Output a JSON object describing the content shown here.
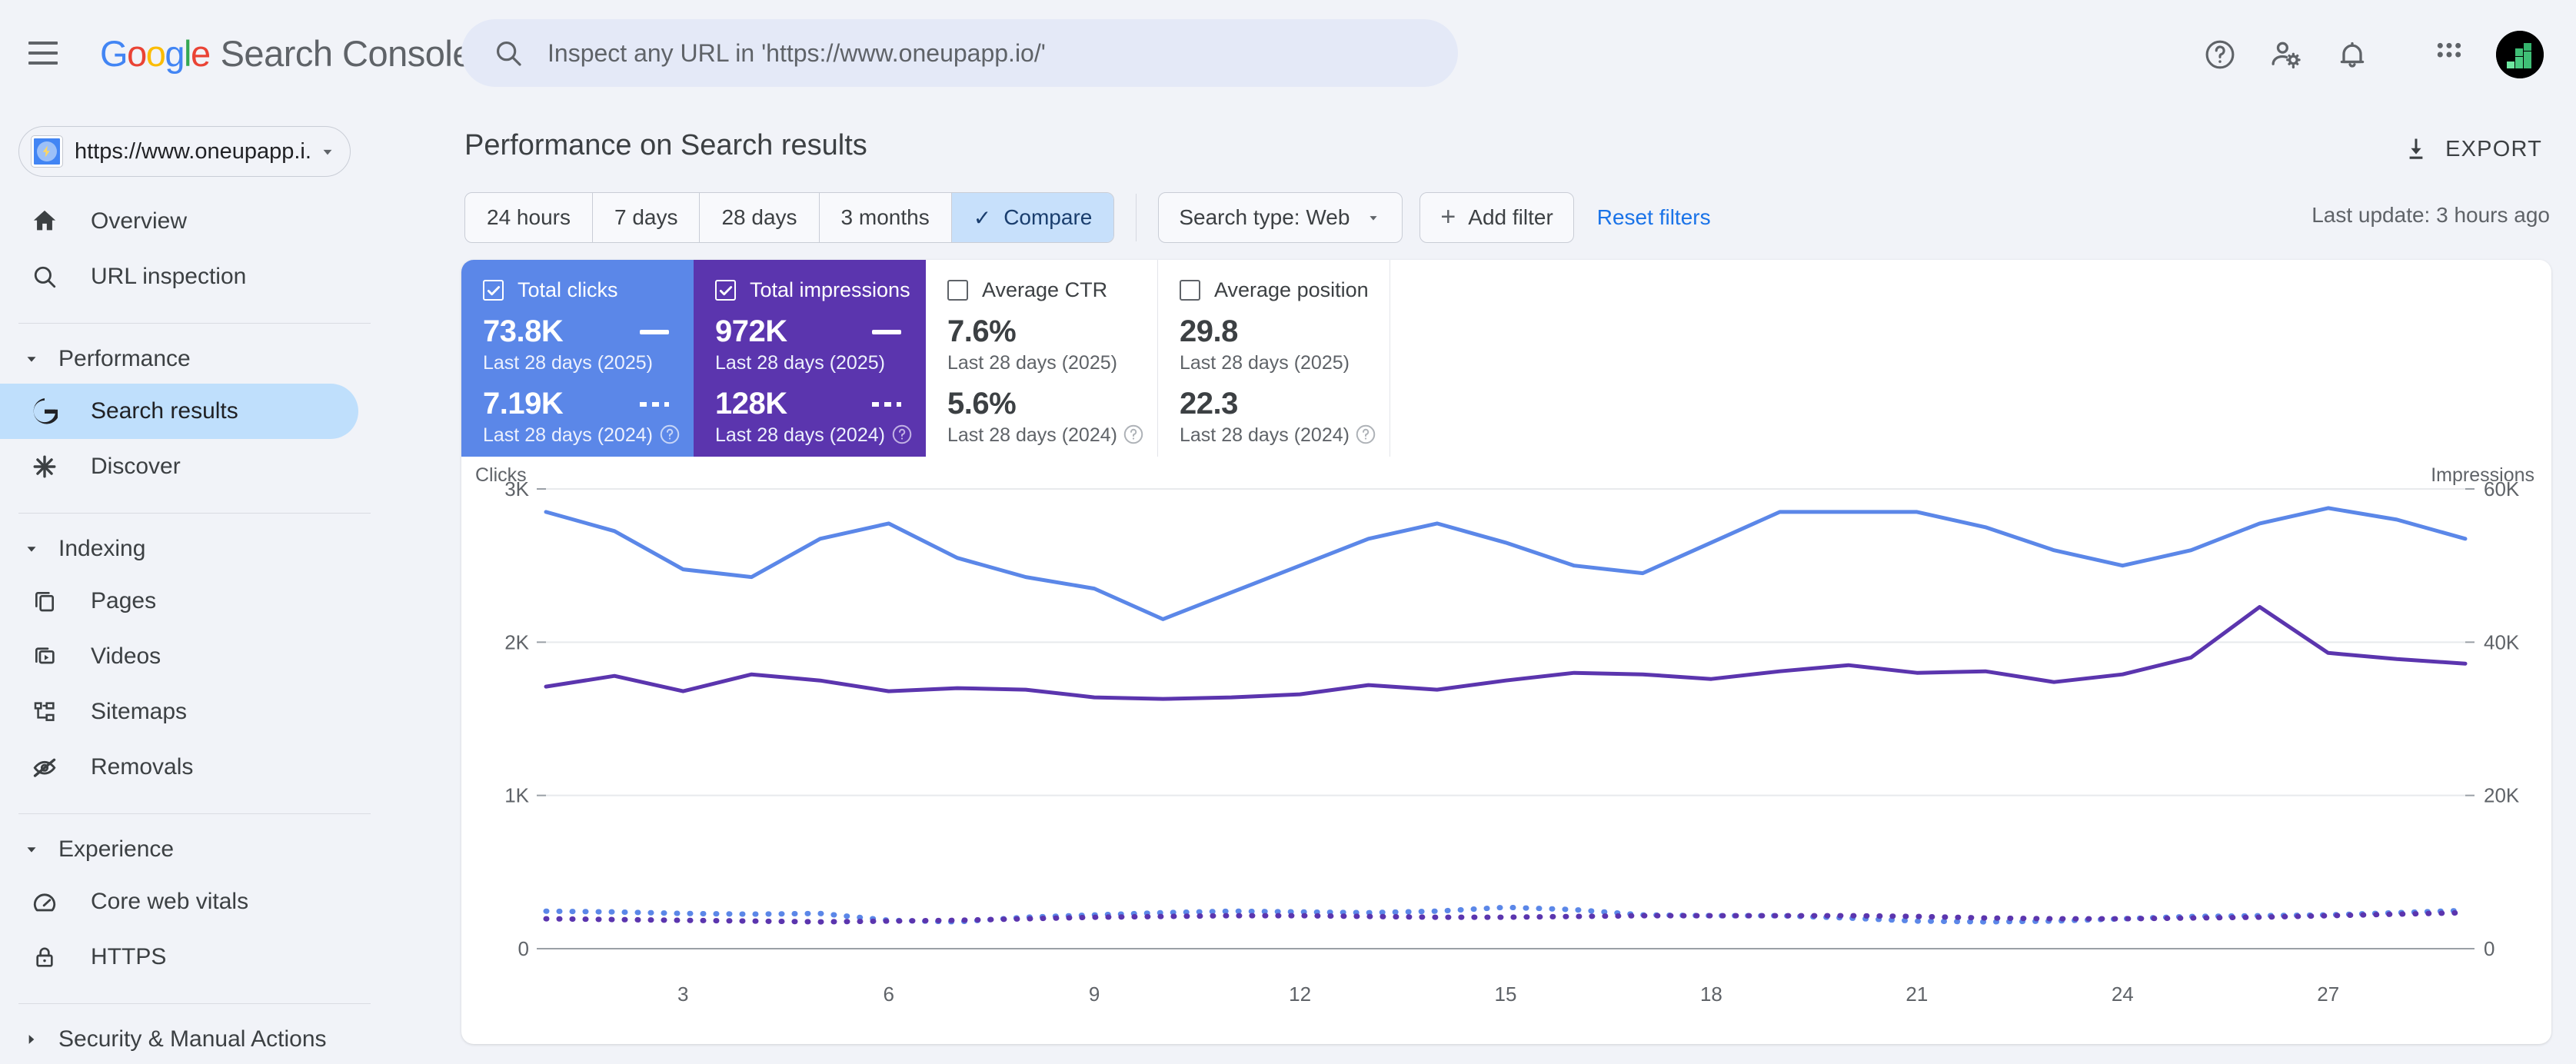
{
  "header": {
    "menu_label": "Main menu",
    "brand_google": [
      "G",
      "o",
      "o",
      "g",
      "l",
      "e"
    ],
    "brand_product": "Search Console",
    "search_placeholder": "Inspect any URL in 'https://www.oneupapp.io/'",
    "search_value": "",
    "icons": [
      "help-icon",
      "account-settings-icon",
      "notifications-icon",
      "apps-grid-icon",
      "avatar"
    ]
  },
  "sidebar": {
    "property": {
      "url": "https://www.oneupapp.i...",
      "favicon": "oneup-favicon"
    },
    "top_items": [
      {
        "label": "Overview",
        "icon": "home-icon",
        "active": false
      },
      {
        "label": "URL inspection",
        "icon": "search-icon",
        "active": false
      }
    ],
    "sections": [
      {
        "title": "Performance",
        "expanded": true,
        "items": [
          {
            "label": "Search results",
            "icon": "google-g-icon",
            "active": true
          },
          {
            "label": "Discover",
            "icon": "discover-asterisk-icon",
            "active": false
          }
        ]
      },
      {
        "title": "Indexing",
        "expanded": true,
        "items": [
          {
            "label": "Pages",
            "icon": "pages-icon",
            "active": false
          },
          {
            "label": "Videos",
            "icon": "videos-icon",
            "active": false
          },
          {
            "label": "Sitemaps",
            "icon": "sitemaps-icon",
            "active": false
          },
          {
            "label": "Removals",
            "icon": "removals-eye-off-icon",
            "active": false
          }
        ]
      },
      {
        "title": "Experience",
        "expanded": true,
        "items": [
          {
            "label": "Core web vitals",
            "icon": "speedometer-icon",
            "active": false
          },
          {
            "label": "HTTPS",
            "icon": "lock-icon",
            "active": false
          }
        ]
      },
      {
        "title": "Security & Manual Actions",
        "expanded": false,
        "items": []
      }
    ]
  },
  "main": {
    "page_title": "Performance on Search results",
    "export_label": "EXPORT",
    "last_update": "Last update: 3 hours ago",
    "date_range_buttons": [
      {
        "label": "24 hours",
        "selected": false
      },
      {
        "label": "7 days",
        "selected": false
      },
      {
        "label": "28 days",
        "selected": false
      },
      {
        "label": "3 months",
        "selected": false
      },
      {
        "label": "Compare",
        "selected": true,
        "check": "✓"
      }
    ],
    "search_type_label": "Search type: Web",
    "add_filter_label": "Add filter",
    "add_filter_plus": "+",
    "reset_filters_label": "Reset filters"
  },
  "metrics": [
    {
      "name": "Total clicks",
      "checked": true,
      "style": "filled-blue",
      "current_value": "73.8K",
      "current_label": "Last 28 days (2025)",
      "compare_value": "7.19K",
      "compare_label": "Last 28 days (2024)",
      "color": "#5B87E8"
    },
    {
      "name": "Total impressions",
      "checked": true,
      "style": "filled-purple",
      "current_value": "972K",
      "current_label": "Last 28 days (2025)",
      "compare_value": "128K",
      "compare_label": "Last 28 days (2024)",
      "color": "#5B35AE"
    },
    {
      "name": "Average CTR",
      "checked": false,
      "style": "plain",
      "current_value": "7.6%",
      "current_label": "Last 28 days (2025)",
      "compare_value": "5.6%",
      "compare_label": "Last 28 days (2024)",
      "color": "#3C4043"
    },
    {
      "name": "Average position",
      "checked": false,
      "style": "plain",
      "current_value": "29.8",
      "current_label": "Last 28 days (2025)",
      "compare_value": "22.3",
      "compare_label": "Last 28 days (2024)",
      "color": "#3C4043"
    }
  ],
  "chart_data": {
    "type": "line",
    "title": "",
    "left_axis_title": "Clicks",
    "right_axis_title": "Impressions",
    "x": [
      1,
      2,
      3,
      4,
      5,
      6,
      7,
      8,
      9,
      10,
      11,
      12,
      13,
      14,
      15,
      16,
      17,
      18,
      19,
      20,
      21,
      22,
      23,
      24,
      25,
      26,
      27,
      28,
      29
    ],
    "xtick_labels": [
      "3",
      "6",
      "9",
      "12",
      "15",
      "18",
      "21",
      "24",
      "27"
    ],
    "xtick_values": [
      3,
      6,
      9,
      12,
      15,
      18,
      21,
      24,
      27
    ],
    "left_ylim": [
      0,
      3000
    ],
    "left_yticks": [
      0,
      1000,
      2000,
      3000
    ],
    "left_ytick_labels": [
      "0",
      "1K",
      "2K",
      "3K"
    ],
    "right_ylim": [
      0,
      60000
    ],
    "right_yticks": [
      0,
      20000,
      40000,
      60000
    ],
    "right_ytick_labels": [
      "0",
      "20K",
      "40K",
      "60K"
    ],
    "grid": true,
    "legend_position": "metric-cards",
    "series": [
      {
        "name": "Total impressions (Last 28 days 2025)",
        "axis": "right",
        "color": "#5B87E8",
        "style": "solid",
        "values": [
          57000,
          54500,
          49500,
          48500,
          53500,
          55500,
          51000,
          48500,
          47000,
          43000,
          46500,
          50000,
          53500,
          55500,
          53000,
          50000,
          49000,
          53000,
          57000,
          57000,
          57000,
          55000,
          52000,
          50000,
          52000,
          55500,
          57500,
          56000,
          53500
        ]
      },
      {
        "name": "Total clicks (Last 28 days 2025)",
        "axis": "left",
        "color": "#5B35AE",
        "style": "solid",
        "values": [
          1710,
          1780,
          1680,
          1790,
          1750,
          1680,
          1700,
          1690,
          1640,
          1630,
          1640,
          1660,
          1720,
          1690,
          1750,
          1800,
          1790,
          1760,
          1810,
          1850,
          1800,
          1810,
          1740,
          1790,
          1900,
          2230,
          1930,
          1890,
          1860
        ]
      },
      {
        "name": "Total impressions (Last 28 days 2024)",
        "axis": "right",
        "color": "#5B87E8",
        "style": "dashed",
        "values": [
          4900,
          4800,
          4600,
          4500,
          4600,
          3700,
          3500,
          4100,
          4400,
          4700,
          4900,
          4800,
          4700,
          4900,
          5400,
          5100,
          4400,
          4300,
          4300,
          4000,
          3600,
          3500,
          3600,
          3900,
          4200,
          4300,
          4400,
          4700,
          5000
        ]
      },
      {
        "name": "Total clicks (Last 28 days 2024)",
        "axis": "left",
        "color": "#5B35AE",
        "style": "dashed",
        "values": [
          195,
          190,
          185,
          180,
          175,
          180,
          185,
          195,
          205,
          210,
          215,
          215,
          210,
          205,
          205,
          210,
          215,
          215,
          215,
          215,
          210,
          200,
          195,
          195,
          200,
          205,
          215,
          225,
          235
        ]
      }
    ]
  }
}
